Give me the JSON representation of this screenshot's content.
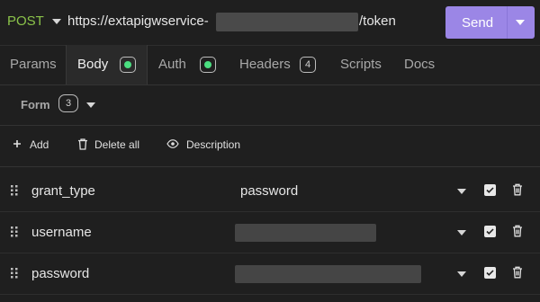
{
  "request": {
    "method": "POST",
    "url_prefix": "https://extapigwservice-",
    "url_suffix": "/token",
    "send_label": "Send"
  },
  "tabs": [
    {
      "label": "Params"
    },
    {
      "label": "Body",
      "indicator": "active-dot"
    },
    {
      "label": "Auth",
      "indicator": "active-dot"
    },
    {
      "label": "Headers",
      "count": "4"
    },
    {
      "label": "Scripts"
    },
    {
      "label": "Docs"
    }
  ],
  "body": {
    "mode_label": "Form",
    "field_count": "3"
  },
  "actions": {
    "add": "Add",
    "delete_all": "Delete all",
    "description": "Description"
  },
  "params": [
    {
      "name": "grant_type",
      "value": "password",
      "enabled": true
    },
    {
      "name": "username",
      "value": "",
      "value_redacted": true,
      "enabled": true
    },
    {
      "name": "password",
      "value": "",
      "value_redacted": true,
      "enabled": true
    }
  ],
  "colors": {
    "method": "#8bc34a",
    "send_button": "#9b86e6",
    "status_dot": "#4ade80",
    "background": "#1f1f1f"
  }
}
